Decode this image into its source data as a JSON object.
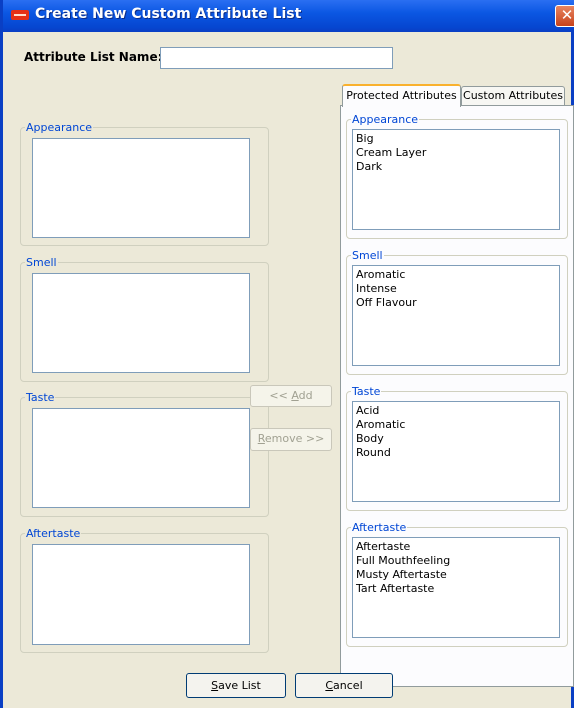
{
  "window": {
    "title": "Create New Custom Attribute List",
    "close_glyph": "✕"
  },
  "form": {
    "name_label": "Attribute List Name:",
    "name_value": "",
    "name_placeholder": ""
  },
  "left_groups": [
    {
      "caption": "Appearance",
      "items": []
    },
    {
      "caption": "Smell",
      "items": []
    },
    {
      "caption": "Taste",
      "items": []
    },
    {
      "caption": "Aftertaste",
      "items": []
    }
  ],
  "middle_buttons": {
    "add_prefix": "<< ",
    "add_mnemonic": "A",
    "add_rest": "dd",
    "remove_mnemonic": "R",
    "remove_rest": "emove >>"
  },
  "tabs": [
    {
      "label": "Protected Attributes",
      "active": true
    },
    {
      "label": "Custom Attributes",
      "active": false
    }
  ],
  "right_groups": [
    {
      "caption": "Appearance",
      "items": [
        "Big",
        "Cream Layer",
        "Dark"
      ]
    },
    {
      "caption": "Smell",
      "items": [
        "Aromatic",
        "Intense",
        "Off Flavour"
      ]
    },
    {
      "caption": "Taste",
      "items": [
        "Acid",
        "Aromatic",
        "Body",
        "Round"
      ]
    },
    {
      "caption": "Aftertaste",
      "items": [
        "Aftertaste",
        "Full Mouthfeeling",
        "Musty Aftertaste",
        "Tart Aftertaste"
      ]
    }
  ],
  "bottom_buttons": {
    "save_mnemonic": "S",
    "save_rest": "ave List",
    "cancel_mnemonic": "C",
    "cancel_rest": "ancel"
  },
  "colors": {
    "titlebar": "#0b57e3",
    "caption_text": "#0046d5",
    "active_tab_accent": "#f9b12e"
  }
}
